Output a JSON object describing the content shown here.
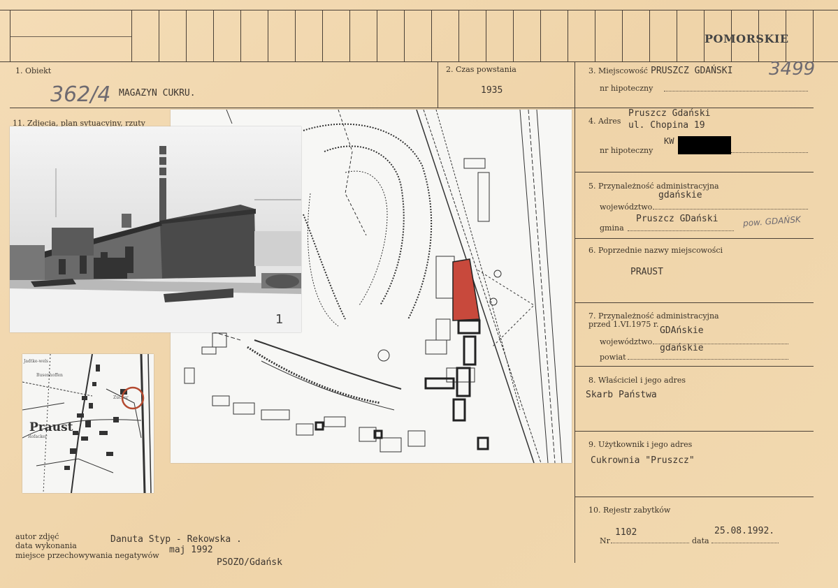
{
  "header": {
    "region_stamp": "POMORSKIE"
  },
  "field1": {
    "label": "1.  Obiekt",
    "catalog_number": "362/4",
    "object_name": "MAGAZYN CUKRU."
  },
  "field2": {
    "label": "2.  Czas powstania",
    "value": "1935"
  },
  "field3": {
    "label": "3.  Miejscowość",
    "place": "PRUSZCZ  GDAŃSKI",
    "mortgage_label": "nr  hipoteczny",
    "handwritten_number": "3499"
  },
  "field4": {
    "label": "4.  Adres",
    "address_line1": "Pruszcz Gdański",
    "address_line2": "ul. Chopina 19",
    "mortgage_label": "nr  hipoteczny",
    "mortgage_prefix": "KW"
  },
  "field5": {
    "label": "5.  Przynależność  administracyjna",
    "voivodeship_label": "województwo",
    "voivodeship": "gdańskie",
    "commune_label": "gmina",
    "commune": "Pruszcz GDański",
    "handwritten_note": "pow. GDAŃSK"
  },
  "field6": {
    "label": "6.  Poprzednie  nazwy  miejscowości",
    "value": "PRAUST"
  },
  "field7": {
    "label_line1": "7.  Przynależność  administracyjna",
    "label_line2": "przed  1.VI.1975 r.",
    "voivodeship_label": "województwo",
    "voivodeship": "GDAńskie",
    "district_label": "powiat",
    "district": "gdańskie"
  },
  "field8": {
    "label": "8.  Właściciel i jego adres",
    "value": "Skarb Państwa"
  },
  "field9": {
    "label": "9.  Użytkownik  i jego adres",
    "value": "Cukrownia \"Pruszcz\""
  },
  "field10": {
    "label": "10.  Rejestr  zabytków",
    "nr_label": "Nr",
    "nr": "1102",
    "date_label": "data",
    "date": "25.08.1992."
  },
  "field11": {
    "label": "11.  Zdjęcia,  plan  sytuacyjny,  rzuty",
    "photo_mark": "1"
  },
  "old_map": {
    "town_label": "Praust"
  },
  "footer": {
    "author_label": "autor  zdjęć",
    "date_label": "data  wykonania",
    "location_label": "miejsce  przechowywania  negatywów",
    "author": "Danuta Styp - Rekowska .",
    "date": "maj 1992",
    "location": "PSOZO/Gdańsk"
  },
  "colors": {
    "card": "#f1d9b2",
    "ink": "#3a3228",
    "highlight": "#c8493c"
  }
}
